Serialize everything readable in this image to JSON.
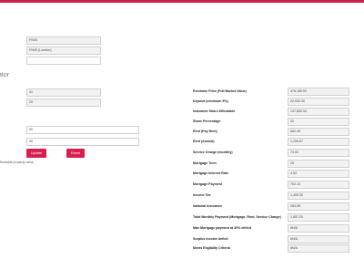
{
  "left": {
    "fields_top": [
      "FN0S",
      "FN0S (London)",
      ""
    ],
    "heading": "ator",
    "fields_mid": [
      "41",
      "20"
    ],
    "fields_inputs": [
      "30",
      "40"
    ],
    "update_label": "Update",
    "reset_label": "Reset",
    "note": "ffordable property value."
  },
  "results": {
    "rows": [
      {
        "label": "Purchase Price (Full Market Value)",
        "value": "478,180.00"
      },
      {
        "label": "Deposit (minimum 5%)",
        "value": "22,932.00"
      },
      {
        "label": "Indicative Share Affordable",
        "value": "137,850.54"
      },
      {
        "label": "Share Percentage",
        "value": "32"
      },
      {
        "label": "Rent (Pay Rent)",
        "value": "862.26"
      },
      {
        "label": "Rent (Annual)",
        "value": "1,226.67"
      },
      {
        "label": "Service Charge (monthly)",
        "value": "74.00"
      },
      {
        "label": "Mortgage Term",
        "value": "25"
      },
      {
        "label": "Mortgage Interest Rate",
        "value": "4.52"
      },
      {
        "label": "Mortgage Payment",
        "value": "702.13"
      },
      {
        "label": "Income Tax",
        "value": "1,490.30"
      },
      {
        "label": "National Insurance",
        "value": "284.98"
      },
      {
        "label": "Total Monthly Payment (Mortgage, Rent, Service Charge)",
        "value": "1,857.20"
      },
      {
        "label": "Max Mortgage payment at 30% deficit",
        "value": "#N/A"
      },
      {
        "label": "Surplus income deficit",
        "value": "#N/A"
      },
      {
        "label": "Meets Eligibility Criteria",
        "value": "#N/A"
      }
    ]
  }
}
